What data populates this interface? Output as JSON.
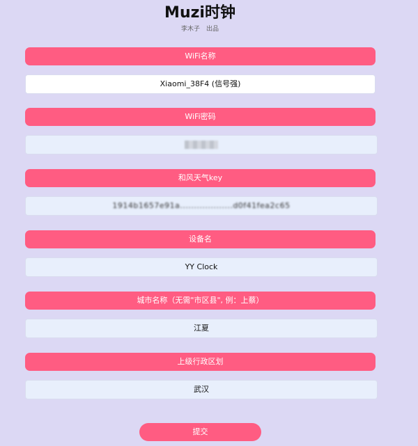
{
  "header": {
    "title": "Muzi时钟",
    "subtitle": "李木子　出品"
  },
  "form": {
    "wifi_name_label": "WiFi名称",
    "wifi_name_value": "Xiaomi_38F4 (信号强)",
    "wifi_password_label": "WiFi密码",
    "weather_key_label": "和风天气key",
    "weather_key_value": "1914b1657e91a...................d0f41fea2c65",
    "device_name_label": "设备名",
    "device_name_value": "YY Clock",
    "city_name_label": "城市名称（无需\"市区县\", 例：上蔡）",
    "city_name_value": "江夏",
    "parent_district_label": "上级行政区划",
    "parent_district_value": "武汉",
    "submit_label": "提交"
  },
  "colors": {
    "background": "#dcd8f4",
    "accent": "#ff5c82",
    "field_bg": "#e8effc"
  }
}
